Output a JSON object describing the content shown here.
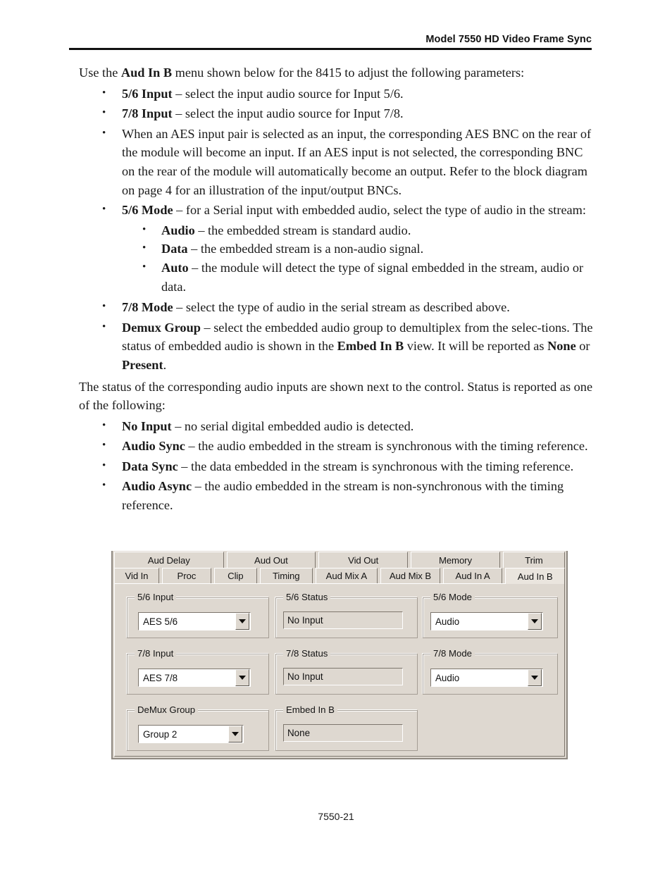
{
  "header": {
    "title": "Model 7550 HD Video Frame Sync"
  },
  "body": {
    "intro_pre": "Use the ",
    "intro_bold": "Aud In B",
    "intro_post": " menu shown below for the 8415 to adjust the following parameters:",
    "bullets": [
      {
        "term": "5/6 Input",
        "text": " – select the input audio source for Input 5/6."
      },
      {
        "term": "7/8 Input",
        "text": " – select the input audio source for Input 7/8."
      }
    ],
    "aes_paragraph": "When an AES input pair is selected as an input, the corresponding AES BNC on the rear of the module will become an input. If an AES input is not selected, the corresponding BNC on the rear of the module will automatically become an output. Refer to the block diagram on page 4 for an illustration of the input/output BNCs.",
    "mode_56": {
      "term": "5/6 Mode",
      "text": " – for a Serial input with embedded audio, select the type of audio in the stream:"
    },
    "mode_sub_bullets": [
      {
        "term": "Audio",
        "text": " – the embedded stream is standard audio."
      },
      {
        "term": "Data",
        "text": " – the embedded stream is a non-audio signal."
      },
      {
        "term": "Auto",
        "text": " – the module will detect the type of signal embedded in the stream, audio or data."
      }
    ],
    "mode_78": {
      "term": "7/8 Mode",
      "text": " – select the type of audio in the serial stream as described above."
    },
    "demux": {
      "term": "Demux Group",
      "part1": " – select the embedded audio group to demultiplex from the selec-tions. The status of embedded audio is shown in the ",
      "bold1": "Embed In B",
      "part2": " view. It will be reported as ",
      "bold2": "None",
      "part3": " or ",
      "bold3": "Present",
      "part4": "."
    },
    "status_paragraph": "The status of the corresponding audio inputs are shown next to the control. Status is reported as one of the following:",
    "status_bullets": [
      {
        "term": "No Input",
        "text": " – no serial digital embedded audio is detected."
      },
      {
        "term": "Audio Sync",
        "text": " – the audio embedded in the stream is synchronous with the timing reference."
      },
      {
        "term": "Data Sync",
        "text": " – the data embedded in the stream is synchronous with the timing reference."
      },
      {
        "term": "Audio Async",
        "text": " – the audio embedded in the stream is non-synchronous with the timing reference."
      }
    ]
  },
  "dialog": {
    "tabs_row1": [
      {
        "label": "Aud Delay",
        "selected": false
      },
      {
        "label": "Aud Out",
        "selected": false
      },
      {
        "label": "Vid Out",
        "selected": false
      },
      {
        "label": "Memory",
        "selected": false
      },
      {
        "label": "Trim",
        "selected": false
      }
    ],
    "tabs_row2": [
      {
        "label": "Vid In",
        "selected": false
      },
      {
        "label": "Proc",
        "selected": false
      },
      {
        "label": "Clip",
        "selected": false
      },
      {
        "label": "Timing",
        "selected": false
      },
      {
        "label": "Aud Mix A",
        "selected": false
      },
      {
        "label": "Aud Mix B",
        "selected": false
      },
      {
        "label": "Aud In A",
        "selected": false
      },
      {
        "label": "Aud In B",
        "selected": true
      }
    ],
    "groups": {
      "input_56": {
        "label": "5/6 Input",
        "value": "AES  5/6"
      },
      "status_56": {
        "label": "5/6 Status",
        "value": "No Input"
      },
      "mode_56": {
        "label": "5/6 Mode",
        "value": "Audio"
      },
      "input_78": {
        "label": "7/8 Input",
        "value": "AES  7/8"
      },
      "status_78": {
        "label": "7/8 Status",
        "value": "No Input"
      },
      "mode_78": {
        "label": "7/8 Mode",
        "value": "Audio"
      },
      "demux_group": {
        "label": "DeMux Group",
        "value": "Group 2"
      },
      "embed_in_b": {
        "label": "Embed In B",
        "value": "None"
      }
    }
  },
  "footer": {
    "page_number": "7550-21"
  },
  "colors": {
    "dialog_face": "#ded8d0",
    "dialog_shadow": "#7d766d",
    "dialog_highlight": "#ffffff",
    "selected_tab": "#eae5de",
    "field_white": "#ffffff"
  }
}
